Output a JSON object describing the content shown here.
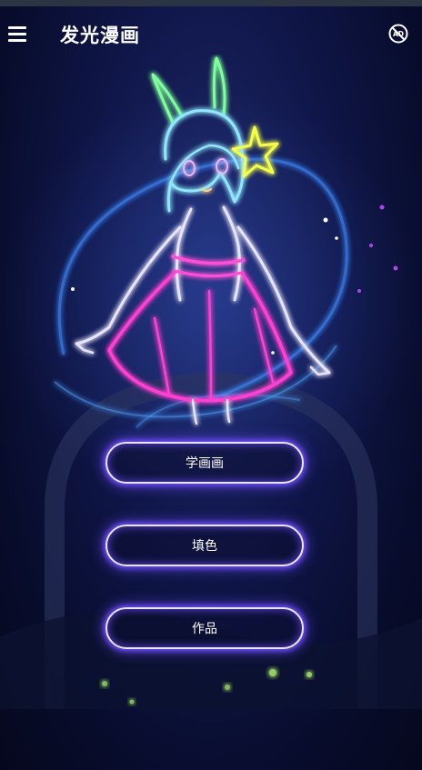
{
  "app": {
    "title": "发光漫画"
  },
  "toolbar": {
    "menu_icon": "hamburger-menu-icon",
    "ad_icon": "no-ads-icon",
    "ad_icon_text": "AD"
  },
  "main": {
    "buttons": [
      {
        "label": "学画画"
      },
      {
        "label": "填色"
      },
      {
        "label": "作品"
      }
    ]
  },
  "colors": {
    "accent_glow": "#6f4cff",
    "background": "#0a0f35"
  }
}
